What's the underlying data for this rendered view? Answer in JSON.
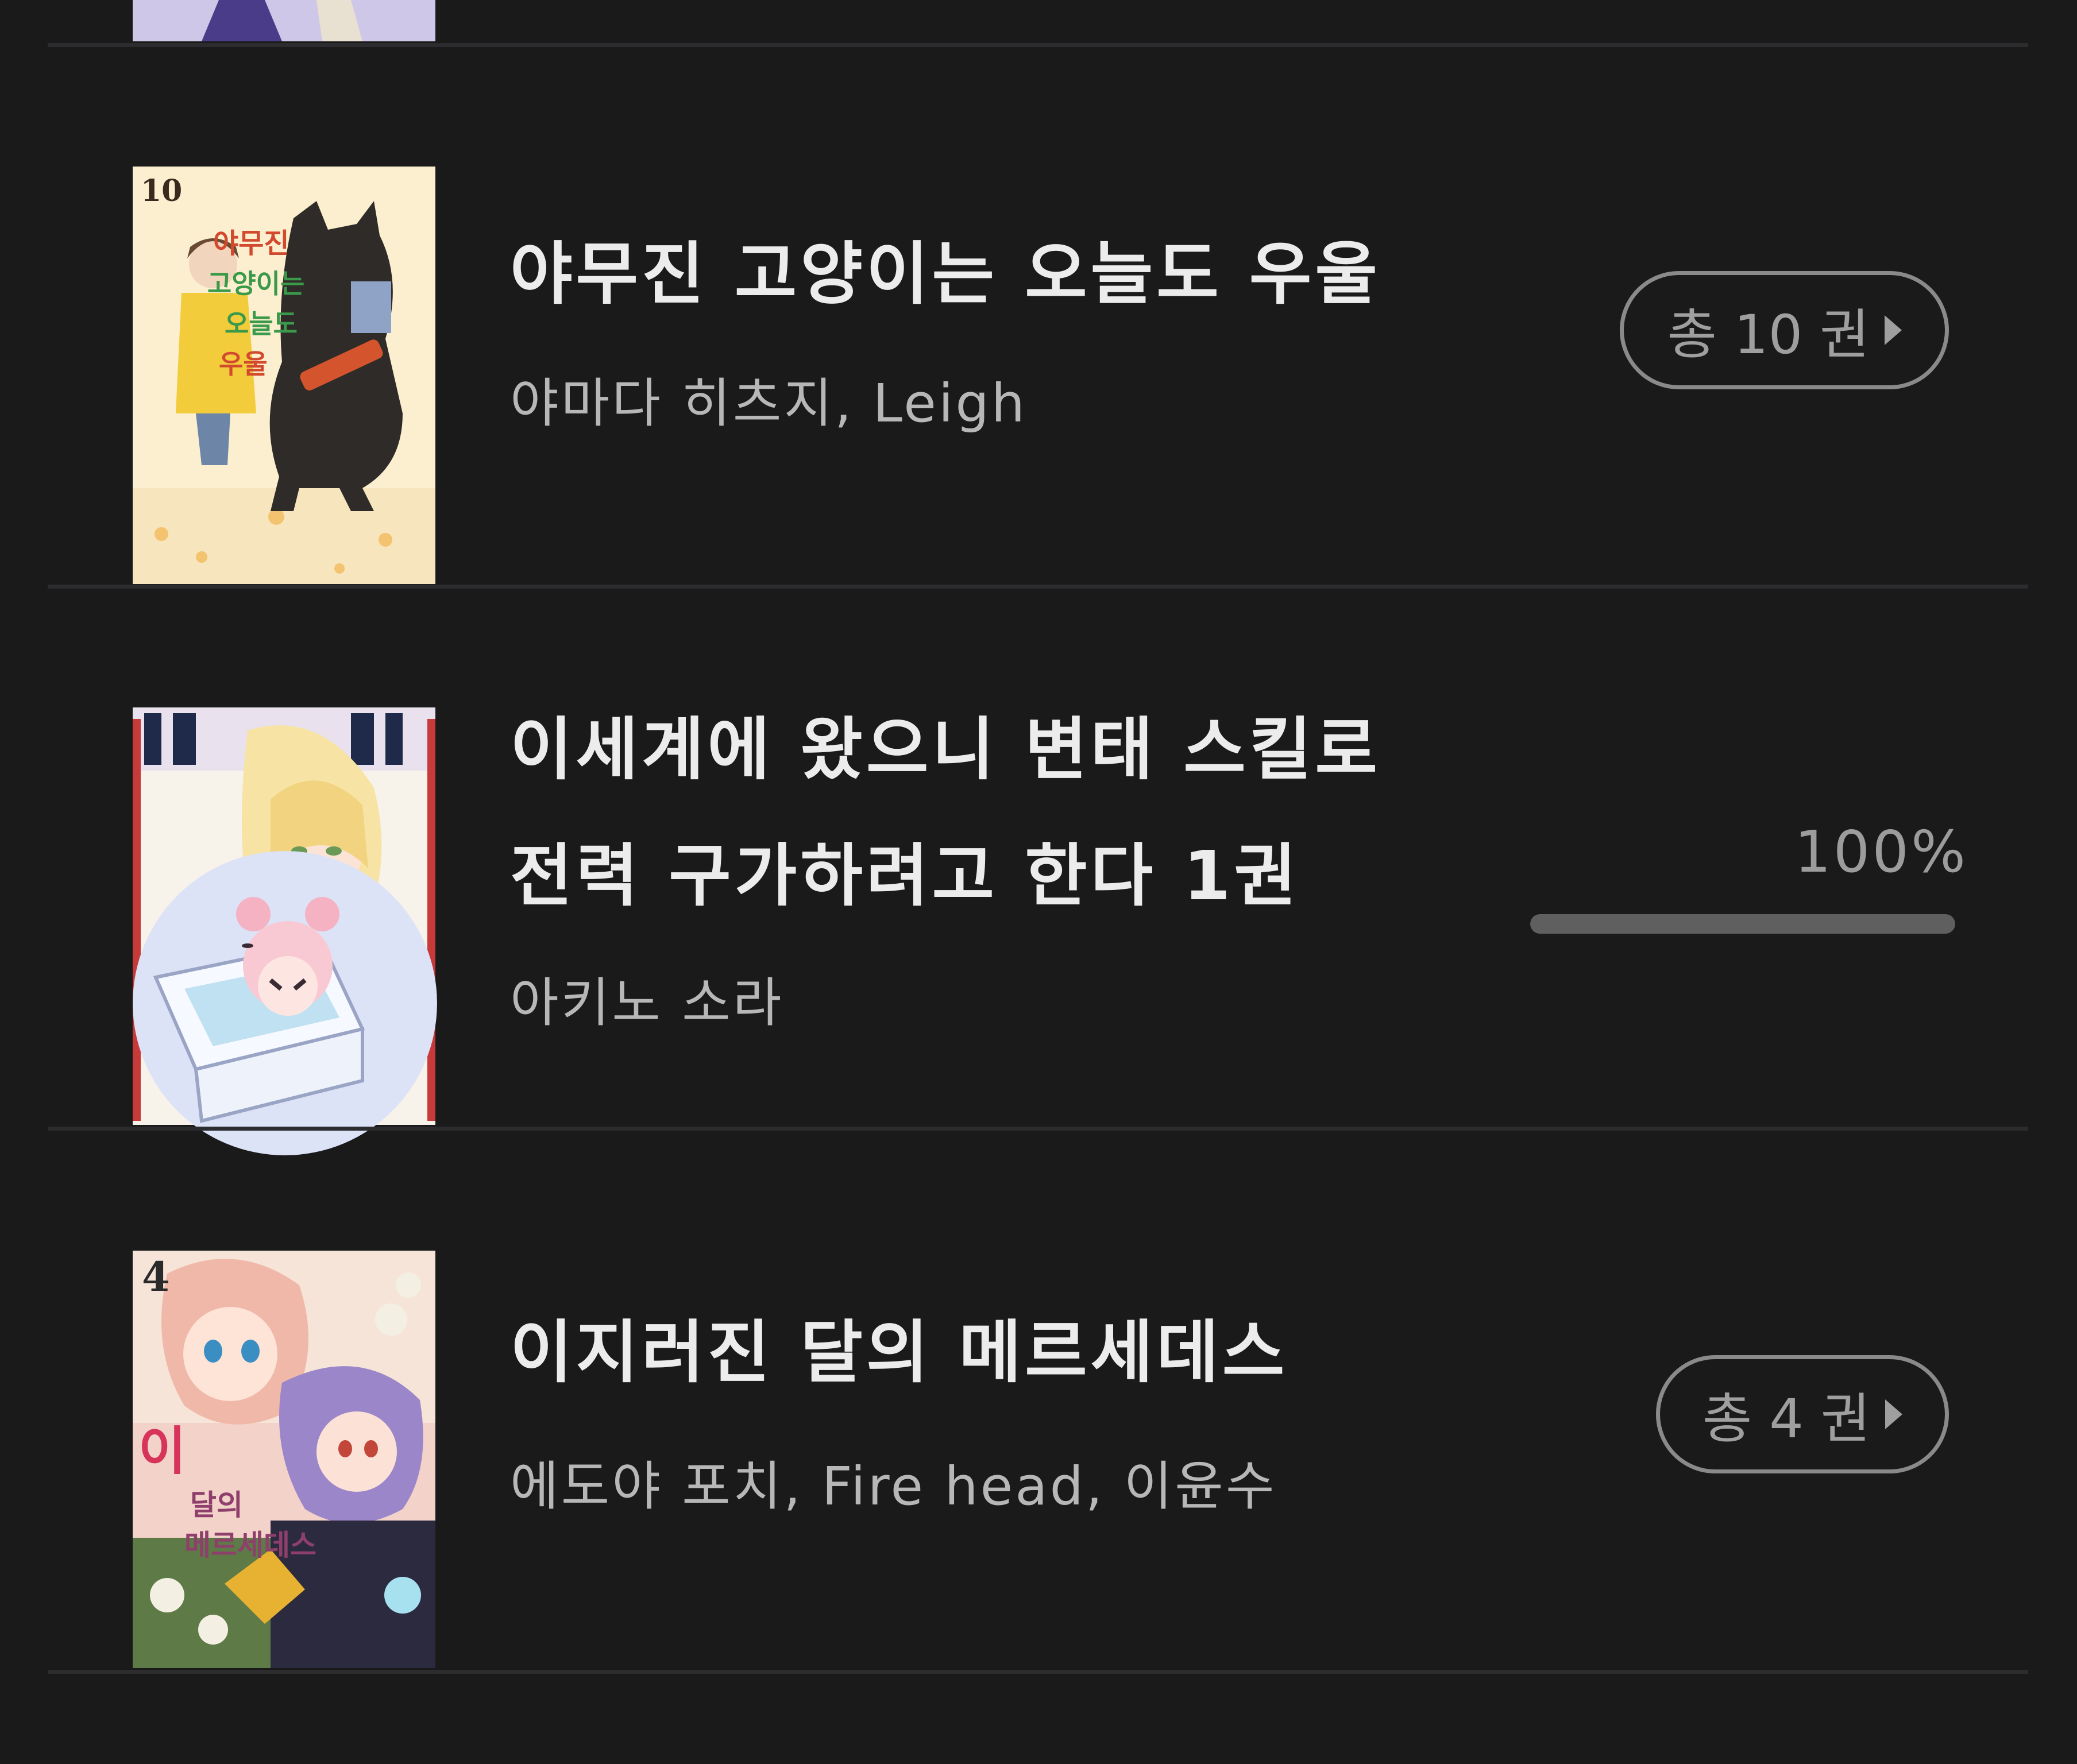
{
  "books": [
    {
      "title_lines": [
        "야무진 고양이는 오늘도 우울"
      ],
      "author": "야마다 히츠지, Leigh",
      "volume_label": "총 10 권",
      "cover_number": "10",
      "cover_title": "야무진 고양이는 오늘도 우울"
    },
    {
      "title_lines": [
        "이세계에 왔으니 변태 스킬로",
        "전력 구가하려고 한다 1권"
      ],
      "author": "아키노 소라",
      "progress_text": "100%",
      "progress": 1.0
    },
    {
      "title_lines": [
        "이지러진 달의 메르세데스"
      ],
      "author": "에도야 포치, Fire head, 이윤수",
      "volume_label": "총 4 권",
      "cover_number": "4",
      "cover_title": "이지러진 달의 메르세데스"
    }
  ],
  "colors": {
    "background": "#1a1a1b",
    "divider": "#2c2c2e",
    "button_border": "#8a8a8a",
    "progress_fill": "#5f5f5f"
  }
}
